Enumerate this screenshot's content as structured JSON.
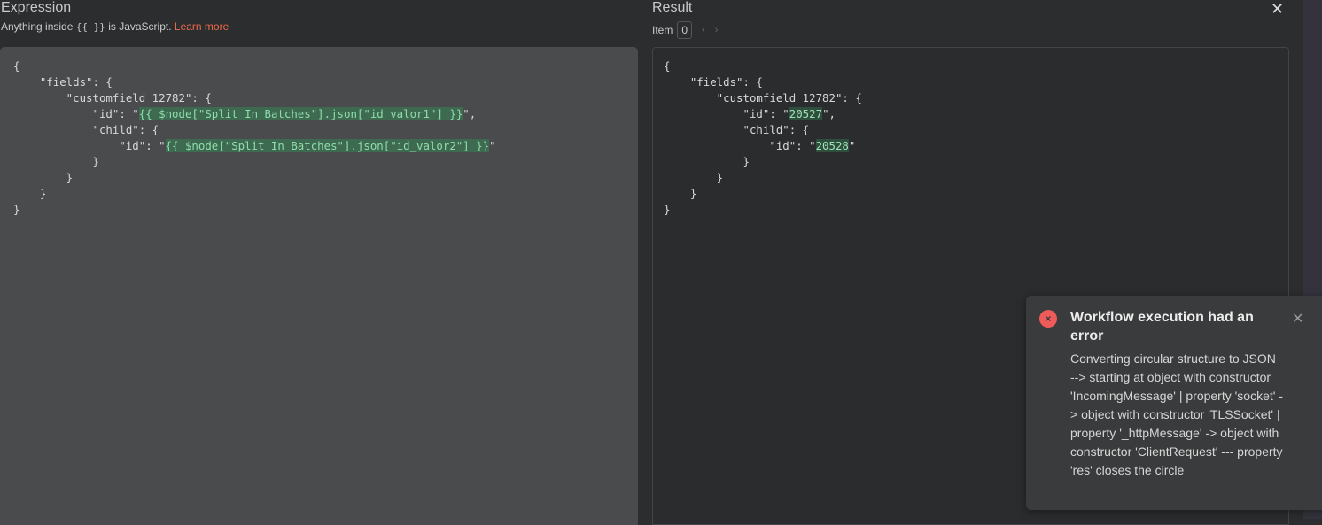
{
  "expression": {
    "title": "Expression",
    "hint_prefix": "Anything inside ",
    "hint_code": "{{  }}",
    "hint_suffix": " is JavaScript. ",
    "learn_more": "Learn more",
    "lines": [
      [
        {
          "t": "{"
        }
      ],
      [
        {
          "t": "    \"fields\": {"
        }
      ],
      [
        {
          "t": "        \"customfield_12782\": {"
        }
      ],
      [
        {
          "t": "            \"id\": \""
        },
        {
          "t": "{{ $node[\"Split In Batches\"].json[\"id_valor1\"] }}",
          "h": true
        },
        {
          "t": "\","
        }
      ],
      [
        {
          "t": "            \"child\": {"
        }
      ],
      [
        {
          "t": "                \"id\": \""
        },
        {
          "t": "{{ $node[\"Split In Batches\"].json[\"id_valor2\"] }}",
          "h": true
        },
        {
          "t": "\""
        }
      ],
      [
        {
          "t": "            }"
        }
      ],
      [
        {
          "t": "        }"
        }
      ],
      [
        {
          "t": "    }"
        }
      ],
      [
        {
          "t": "}"
        }
      ]
    ]
  },
  "result": {
    "title": "Result",
    "item_label": "Item",
    "item_value": "0",
    "prev": "‹",
    "next": "›",
    "close": "✕",
    "lines": [
      [
        {
          "t": "{"
        }
      ],
      [
        {
          "t": "    \"fields\": {"
        }
      ],
      [
        {
          "t": "        \"customfield_12782\": {"
        }
      ],
      [
        {
          "t": "            \"id\": \""
        },
        {
          "t": "20527",
          "h": true
        },
        {
          "t": "\","
        }
      ],
      [
        {
          "t": "            \"child\": {"
        }
      ],
      [
        {
          "t": "                \"id\": \""
        },
        {
          "t": "20528",
          "h": true
        },
        {
          "t": "\""
        }
      ],
      [
        {
          "t": "            }"
        }
      ],
      [
        {
          "t": "        }"
        }
      ],
      [
        {
          "t": "    }"
        }
      ],
      [
        {
          "t": "}"
        }
      ]
    ]
  },
  "toast": {
    "icon": "×",
    "title": "Workflow execution had an error",
    "message": "Converting circular structure to JSON --> starting at object with constructor 'IncomingMessage' | property 'socket' -> object with constructor 'TLSSocket' | property '_httpMessage' -> object with constructor 'ClientRequest' --- property 'res' closes the circle",
    "close": "✕"
  }
}
